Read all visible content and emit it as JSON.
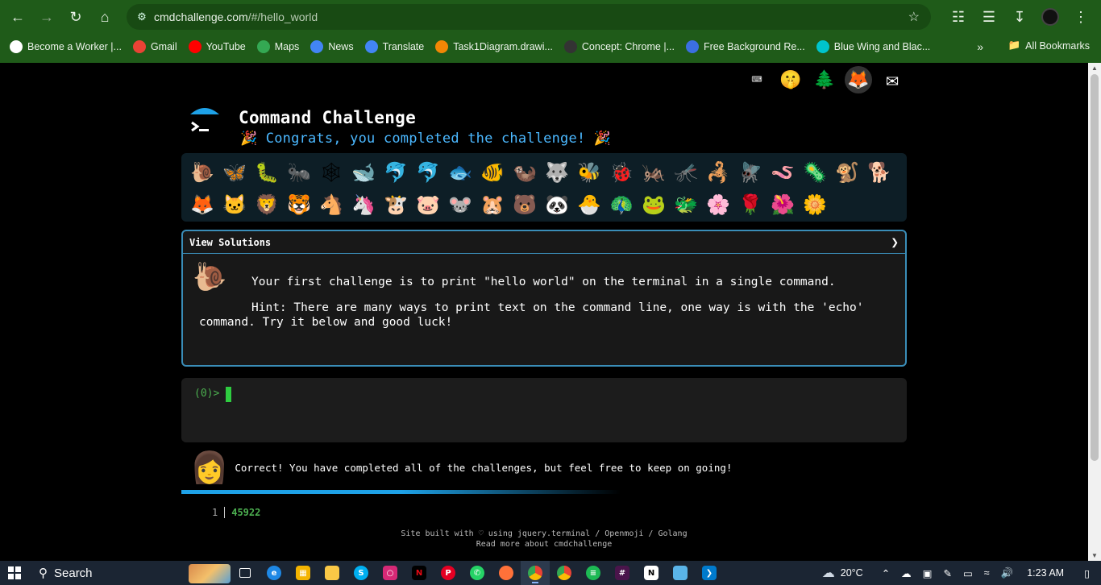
{
  "browser": {
    "url_host": "cmdchallenge.com",
    "url_path": "/#/hello_world",
    "bookmarks": [
      {
        "label": "Become a Worker |...",
        "color": "#ffffff"
      },
      {
        "label": "Gmail",
        "color": "#ea4335"
      },
      {
        "label": "YouTube",
        "color": "#ff0000"
      },
      {
        "label": "Maps",
        "color": "#34a853"
      },
      {
        "label": "News",
        "color": "#4285f4"
      },
      {
        "label": "Translate",
        "color": "#4285f4"
      },
      {
        "label": "Task1Diagram.drawi...",
        "color": "#f08705"
      },
      {
        "label": "Concept: Chrome |...",
        "color": "#333333"
      },
      {
        "label": "Free Background Re...",
        "color": "#3b6fe0"
      },
      {
        "label": "Blue Wing and Blac...",
        "color": "#00c4cc"
      }
    ],
    "all_bookmarks": "All Bookmarks"
  },
  "page": {
    "title": "Command Challenge",
    "congrats": "🎉 Congrats, you completed the challenge! 🎉",
    "top_icons": [
      "⌨",
      "🤫",
      "🌲",
      "🦊",
      "✉"
    ],
    "emojis": [
      "🐌",
      "🦋",
      "🐛",
      "🐜",
      "🕸",
      "🐋",
      "🐬",
      "🐬",
      "🐟",
      "🐠",
      "🦦",
      "🐺",
      "🐝",
      "🐞",
      "🦗",
      "🦟",
      "🦂",
      "🪰",
      "🪱",
      "🦠",
      "🐒",
      "🐕",
      "🦊",
      "🐱",
      "🦁",
      "🐯",
      "🐴",
      "🦄",
      "🐮",
      "🐷",
      "🐭",
      "🐹",
      "🐻",
      "🐼",
      "🐣",
      "🦚",
      "🐸",
      "🐲",
      "🌸",
      "🌹",
      "🌺",
      "🌼"
    ],
    "solutions_label": "View Solutions",
    "challenge_text": "Your first challenge is to print \"hello world\" on the terminal in a single command.",
    "hint_text": "Hint: There are many ways to print text on the command line, one way is with the 'echo' command. Try it below and good luck!",
    "prompt": "(0)>",
    "correct_text": "Correct! You have completed all of the challenges, but feel free to keep on going!",
    "counter_index": "1",
    "counter_value": "45922",
    "footer_line1": "Site built with ♡ using jquery.terminal / Openmoji / Golang",
    "footer_line2": "Read more about cmdchallenge"
  },
  "taskbar": {
    "search_label": "Search",
    "weather": "20°C",
    "time": "1:23 AM"
  }
}
